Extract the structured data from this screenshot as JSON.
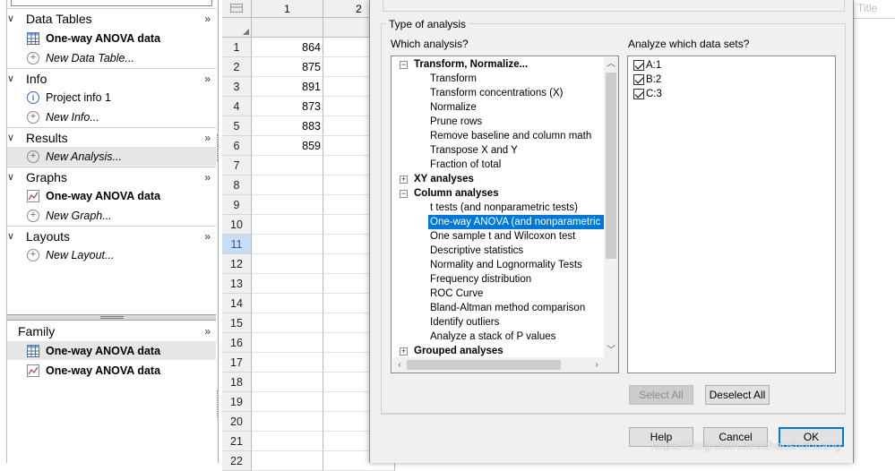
{
  "navigator": {
    "sections": [
      {
        "title": "Data Tables",
        "more": "»"
      },
      {
        "title": "Info",
        "more": "»"
      },
      {
        "title": "Results",
        "more": "»"
      },
      {
        "title": "Graphs",
        "more": "»"
      },
      {
        "title": "Layouts",
        "more": "»"
      }
    ],
    "data_tables": {
      "item": "One-way ANOVA data",
      "new": "New Data Table..."
    },
    "info": {
      "item": "Project info 1",
      "new": "New Info..."
    },
    "results": {
      "new": "New Analysis..."
    },
    "graphs": {
      "item": "One-way ANOVA data",
      "new": "New Graph..."
    },
    "layouts": {
      "new": "New Layout..."
    },
    "family": {
      "title": "Family",
      "more": "»",
      "items": [
        "One-way ANOVA data",
        "One-way ANOVA data"
      ]
    }
  },
  "sheet": {
    "columns": [
      "1",
      "2"
    ],
    "rows": [
      "1",
      "2",
      "3",
      "4",
      "5",
      "6",
      "7",
      "8",
      "9",
      "10",
      "11",
      "12",
      "13",
      "14",
      "15",
      "16",
      "17",
      "18",
      "19",
      "20",
      "21",
      "22"
    ],
    "values": [
      "864",
      "875",
      "891",
      "873",
      "883",
      "859"
    ],
    "active_row": "11"
  },
  "background": {
    "title_hint": "Title"
  },
  "dialog": {
    "group_title": "Type of analysis",
    "which_analysis_label": "Which analysis?",
    "datasets_label": "Analyze which data sets?",
    "tree": {
      "cat1": {
        "label": "Transform, Normalize...",
        "exp": "−"
      },
      "cat1_items": [
        "Transform",
        "Transform concentrations (X)",
        "Normalize",
        "Prune rows",
        "Remove baseline and column math",
        "Transpose X and Y",
        "Fraction of total"
      ],
      "cat2": {
        "label": "XY analyses",
        "exp": "+"
      },
      "cat3": {
        "label": "Column analyses",
        "exp": "−"
      },
      "cat3_items": [
        "t tests (and nonparametric tests)",
        "One-way ANOVA (and nonparametric or",
        "One sample t and Wilcoxon test",
        "Descriptive statistics",
        "Normality and Lognormality Tests",
        "Frequency distribution",
        "ROC Curve",
        "Bland-Altman method comparison",
        "Identify outliers",
        "Analyze a stack of P values"
      ],
      "cat4": {
        "label": "Grouped analyses",
        "exp": "+"
      }
    },
    "datasets": [
      "A:1",
      "B:2",
      "C:3"
    ],
    "buttons": {
      "select_all": "Select All",
      "deselect_all": "Deselect All",
      "help": "Help",
      "cancel": "Cancel",
      "ok": "OK"
    },
    "watermark": "https://blog.csdn.net/zhaoshuhuang"
  }
}
